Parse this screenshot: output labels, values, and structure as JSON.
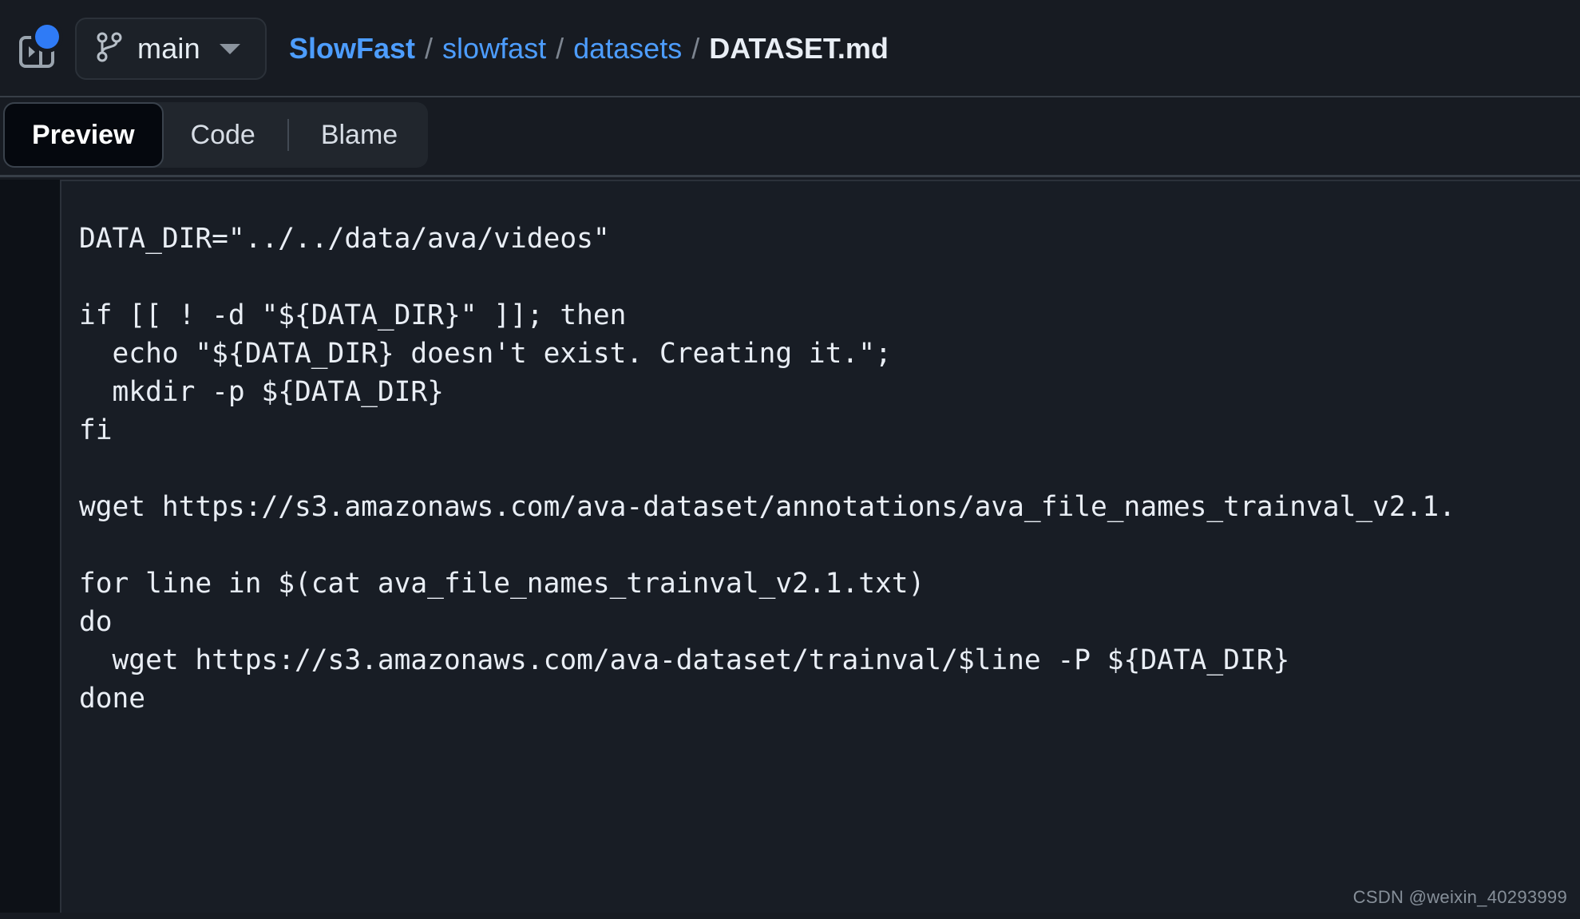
{
  "colors": {
    "page_bg": "#171b22",
    "content_bg": "#0d1117",
    "code_bg": "#181d25",
    "link_blue": "#4d9dff",
    "accent_dot": "#2f7bf6",
    "text": "#e6edf3",
    "muted": "#7d8590"
  },
  "header": {
    "panel_toggle_icon": "open-side-panel-icon",
    "notification_dot_icon": "notification-dot-icon",
    "branch": {
      "icon": "branch-icon",
      "name": "main",
      "caret_icon": "chevron-down-icon"
    },
    "breadcrumb": {
      "separator": "/",
      "items": [
        {
          "label": "SlowFast",
          "kind": "repo-link"
        },
        {
          "label": "slowfast",
          "kind": "dir-link"
        },
        {
          "label": "datasets",
          "kind": "dir-link"
        },
        {
          "label": "DATASET.md",
          "kind": "current-file"
        }
      ]
    }
  },
  "tabs": {
    "active": "Preview",
    "items": [
      {
        "label": "Preview",
        "active": true
      },
      {
        "label": "Code",
        "active": false
      },
      {
        "label": "Blame",
        "active": false
      }
    ]
  },
  "code": {
    "language": "shell",
    "lines": [
      "DATA_DIR=\"../../data/ava/videos\"",
      "",
      "if [[ ! -d \"${DATA_DIR}\" ]]; then",
      "  echo \"${DATA_DIR} doesn't exist. Creating it.\";",
      "  mkdir -p ${DATA_DIR}",
      "fi",
      "",
      "wget https://s3.amazonaws.com/ava-dataset/annotations/ava_file_names_trainval_v2.1.",
      "",
      "for line in $(cat ava_file_names_trainval_v2.1.txt)",
      "do",
      "  wget https://s3.amazonaws.com/ava-dataset/trainval/$line -P ${DATA_DIR}",
      "done"
    ]
  },
  "watermark": {
    "text": "CSDN @weixin_40293999"
  }
}
